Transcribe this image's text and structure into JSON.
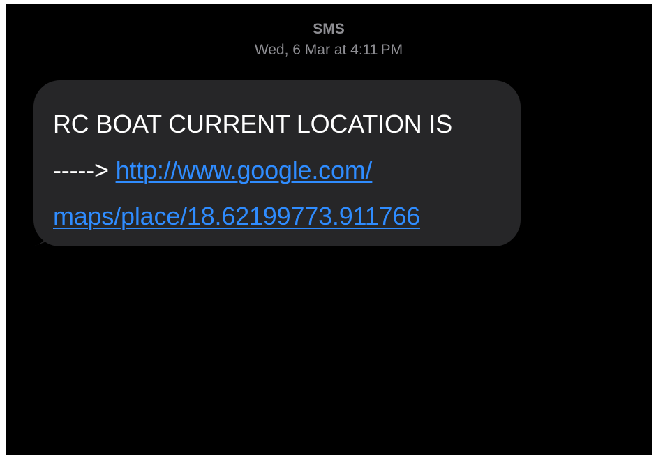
{
  "header": {
    "channel": "SMS",
    "timestamp": "Wed, 6 Mar at 4:11 PM"
  },
  "message": {
    "text_line1": "RC BOAT CURRENT LOCATION IS",
    "arrow": "----->",
    "link_part1": "http://www.google.com/",
    "link_part2": "maps/place/18.62199773.911766"
  },
  "colors": {
    "background": "#000000",
    "bubble": "#262628",
    "meta_text": "#8e8e93",
    "link": "#2f8cff"
  }
}
